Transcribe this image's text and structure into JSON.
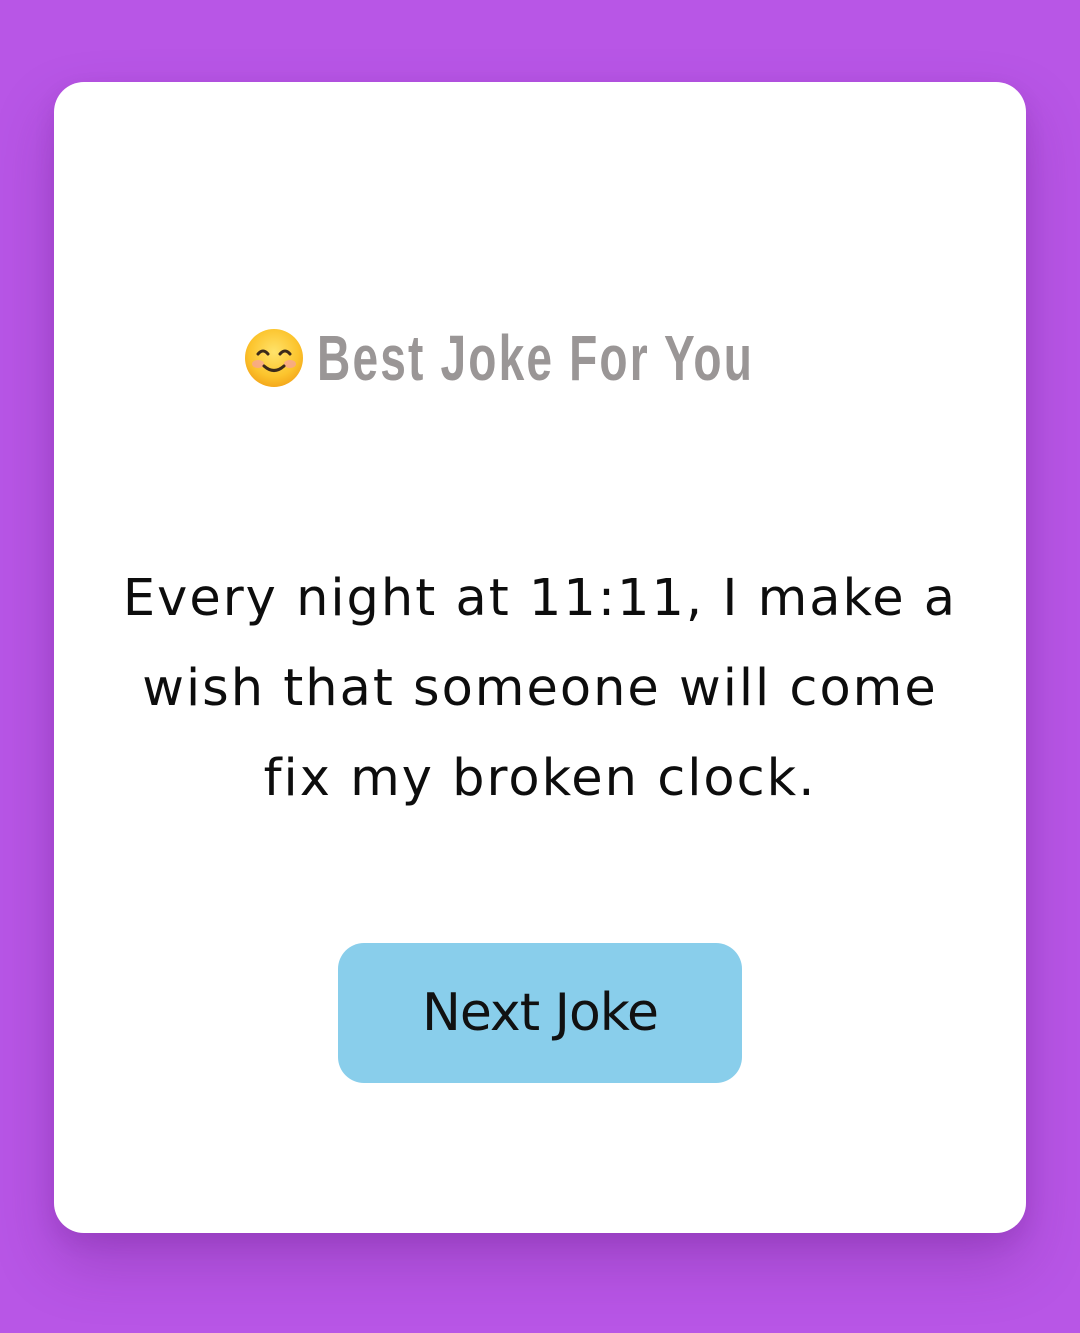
{
  "header": {
    "emoji_icon": "smiling-face-icon",
    "title": "Best Joke For You"
  },
  "joke": {
    "text": "Every night at 11:11, I make a wish that someone will come fix my broken clock."
  },
  "actions": {
    "next_label": "Next Joke"
  },
  "colors": {
    "background": "#b856e6",
    "card": "#ffffff",
    "title": "#9a9696",
    "button": "#89ceeb"
  }
}
